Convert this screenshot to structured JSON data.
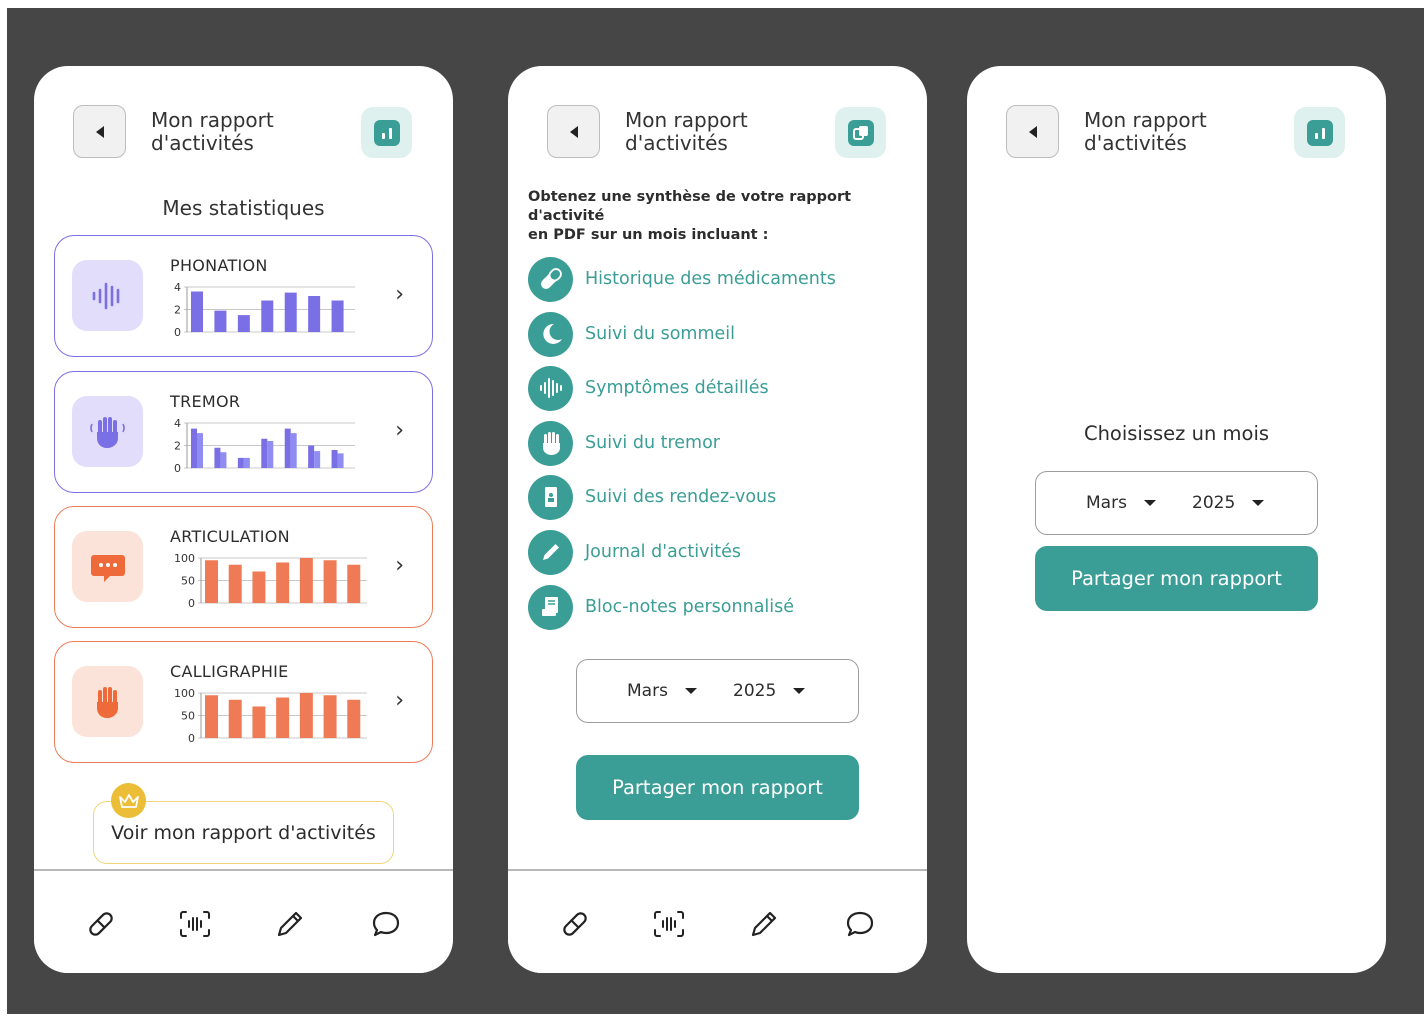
{
  "header": {
    "title_line1": "Mon rapport",
    "title_line2": "d'activités"
  },
  "screen1": {
    "section_title": "Mes statistiques",
    "cards": [
      {
        "title": "PHONATION",
        "icon": "sound-wave-icon",
        "accent": "#7b6fe6",
        "chart_data": {
          "type": "bar",
          "yticks": [
            "4",
            "2",
            "0"
          ],
          "ylim": [
            0,
            4
          ],
          "values": [
            3.6,
            1.9,
            1.5,
            2.8,
            3.5,
            3.2,
            2.8
          ]
        }
      },
      {
        "title": "TREMOR",
        "icon": "hand-tremor-icon",
        "accent": "#7b6fe6",
        "chart_data": {
          "type": "bar",
          "yticks": [
            "4",
            "2",
            "0"
          ],
          "ylim": [
            0,
            4
          ],
          "series": [
            {
              "values": [
                3.5,
                1.8,
                0.9,
                2.6,
                3.5,
                2.0,
                1.6
              ]
            },
            {
              "values": [
                3.1,
                1.4,
                0.9,
                2.4,
                3.1,
                1.5,
                1.3
              ]
            }
          ]
        }
      },
      {
        "title": "ARTICULATION",
        "icon": "speech-bubble-icon",
        "accent": "#ef7b56",
        "chart_data": {
          "type": "bar",
          "yticks": [
            "100",
            "50",
            "0"
          ],
          "ylim": [
            0,
            100
          ],
          "values": [
            95,
            85,
            70,
            90,
            100,
            95,
            85
          ]
        }
      },
      {
        "title": "CALLIGRAPHIE",
        "icon": "hand-icon",
        "accent": "#ef7b56",
        "chart_data": {
          "type": "bar",
          "yticks": [
            "100",
            "50",
            "0"
          ],
          "ylim": [
            0,
            100
          ],
          "values": [
            95,
            85,
            70,
            90,
            100,
            95,
            85
          ]
        }
      }
    ],
    "premium_button": "Voir mon rapport d'activités"
  },
  "screen2": {
    "intro_line1": "Obtenez une synthèse de votre rapport d'activité",
    "intro_line2": "en PDF sur un mois incluant :",
    "features": [
      {
        "label": "Historique des médicaments",
        "icon": "pill-icon"
      },
      {
        "label": "Suivi du sommeil",
        "icon": "moon-icon"
      },
      {
        "label": "Symptômes détaillés",
        "icon": "sound-wave-icon"
      },
      {
        "label": "Suivi du tremor",
        "icon": "hand-icon"
      },
      {
        "label": "Suivi des rendez-vous",
        "icon": "id-badge-icon"
      },
      {
        "label": "Journal d'activités",
        "icon": "pencil-icon"
      },
      {
        "label": "Bloc-notes personnalisé",
        "icon": "notepad-icon"
      }
    ]
  },
  "screen3": {
    "choose_label": "Choisissez un mois"
  },
  "month_select": {
    "month": "Mars",
    "year": "2025"
  },
  "share_button": "Partager mon rapport",
  "nav": [
    "pill-icon",
    "scan-icon",
    "pencil-icon",
    "chat-icon"
  ],
  "colors": {
    "teal": "#3b9e96",
    "purple": "#7b6fe6",
    "orange": "#ef7b56",
    "gold": "#ecbd36",
    "background": "#464646"
  }
}
